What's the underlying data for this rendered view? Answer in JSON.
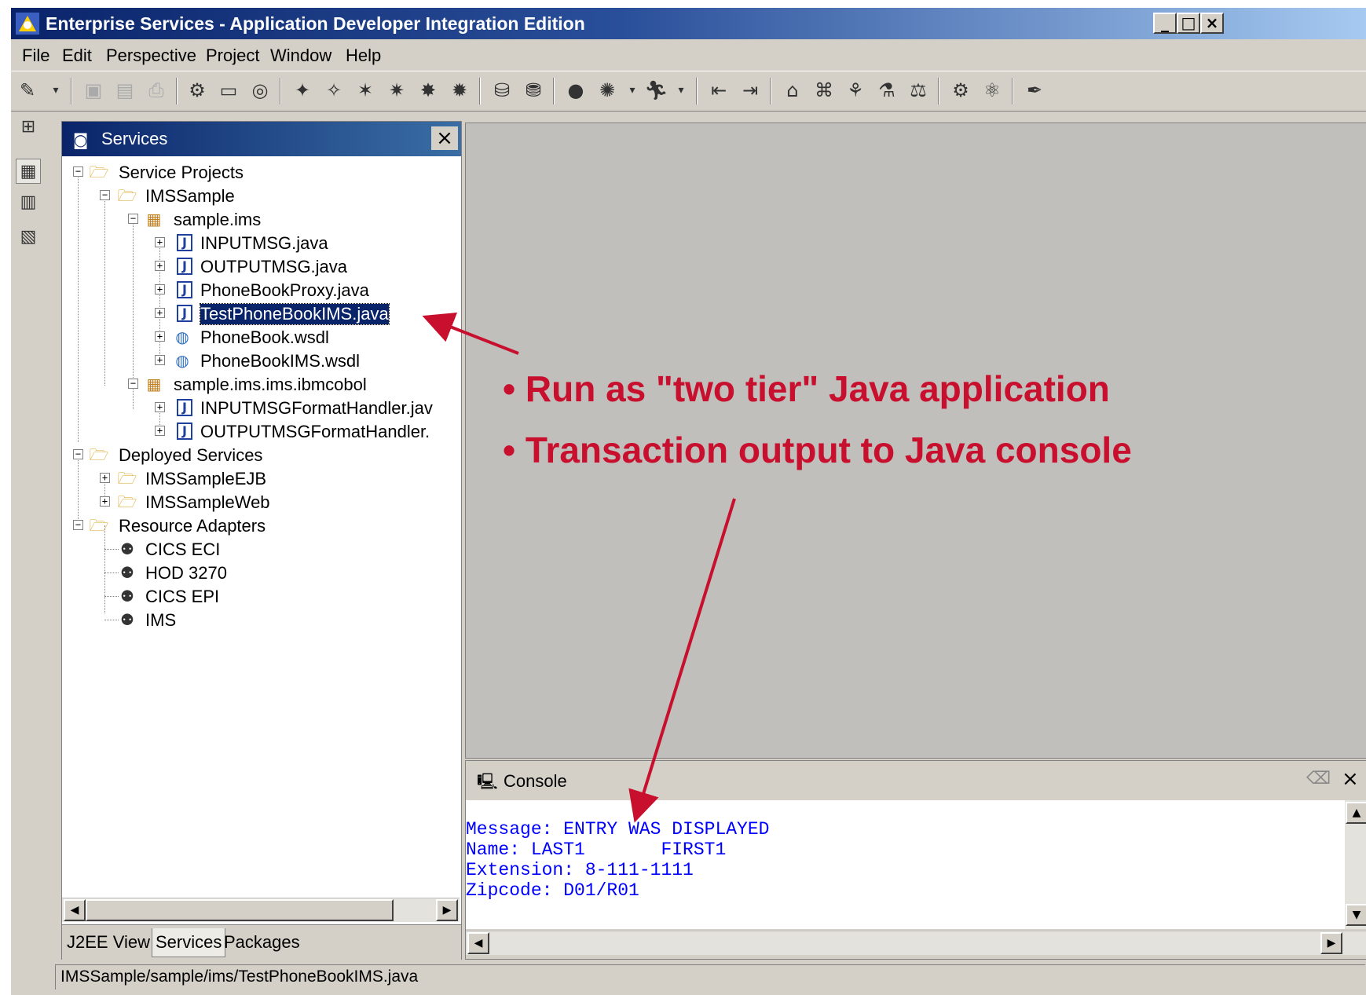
{
  "window": {
    "title": "Enterprise Services - Application Developer Integration Edition",
    "caption_buttons": {
      "minimize": "_",
      "maximize": "□",
      "close": "×"
    }
  },
  "menu": [
    "File",
    "Edit",
    "Perspective",
    "Project",
    "Window",
    "Help"
  ],
  "services_view": {
    "title": "Services",
    "close": "×",
    "tree": {
      "service_projects": "Service Projects",
      "imssample": "IMSSample",
      "pkg1": "sample.ims",
      "files1": [
        "INPUTMSG.java",
        "OUTPUTMSG.java",
        "PhoneBookProxy.java",
        "TestPhoneBookIMS.java",
        "PhoneBook.wsdl",
        "PhoneBookIMS.wsdl"
      ],
      "pkg2": "sample.ims.ims.ibmcobol",
      "files2": [
        "INPUTMSGFormatHandler.jav",
        "OUTPUTMSGFormatHandler."
      ],
      "deployed_services": "Deployed Services",
      "deployed": [
        "IMSSampleEJB",
        "IMSSampleWeb"
      ],
      "resource_adapters": "Resource Adapters",
      "adapters": [
        "CICS ECI",
        "HOD 3270",
        "CICS EPI",
        "IMS"
      ]
    },
    "tabs": [
      "J2EE View",
      "Services",
      "Packages"
    ],
    "active_tab": "Services"
  },
  "console": {
    "title": "Console",
    "close": "×",
    "lines": [
      "Message: ENTRY WAS DISPLAYED",
      "Name: LAST1       FIRST1",
      "Extension: 8-111-1111",
      "Zipcode: D01/R01"
    ]
  },
  "status_bar": "IMSSample/sample/ims/TestPhoneBookIMS.java",
  "annotations": {
    "bullet1": "• Run as \"two tier\" Java application",
    "bullet2": "• Transaction output to Java console",
    "color": "#c8102e"
  },
  "colors": {
    "titlebar": "#0a246a",
    "chrome": "#d4d0c8",
    "console_text": "#0000ff",
    "selection": "#0a246a"
  }
}
